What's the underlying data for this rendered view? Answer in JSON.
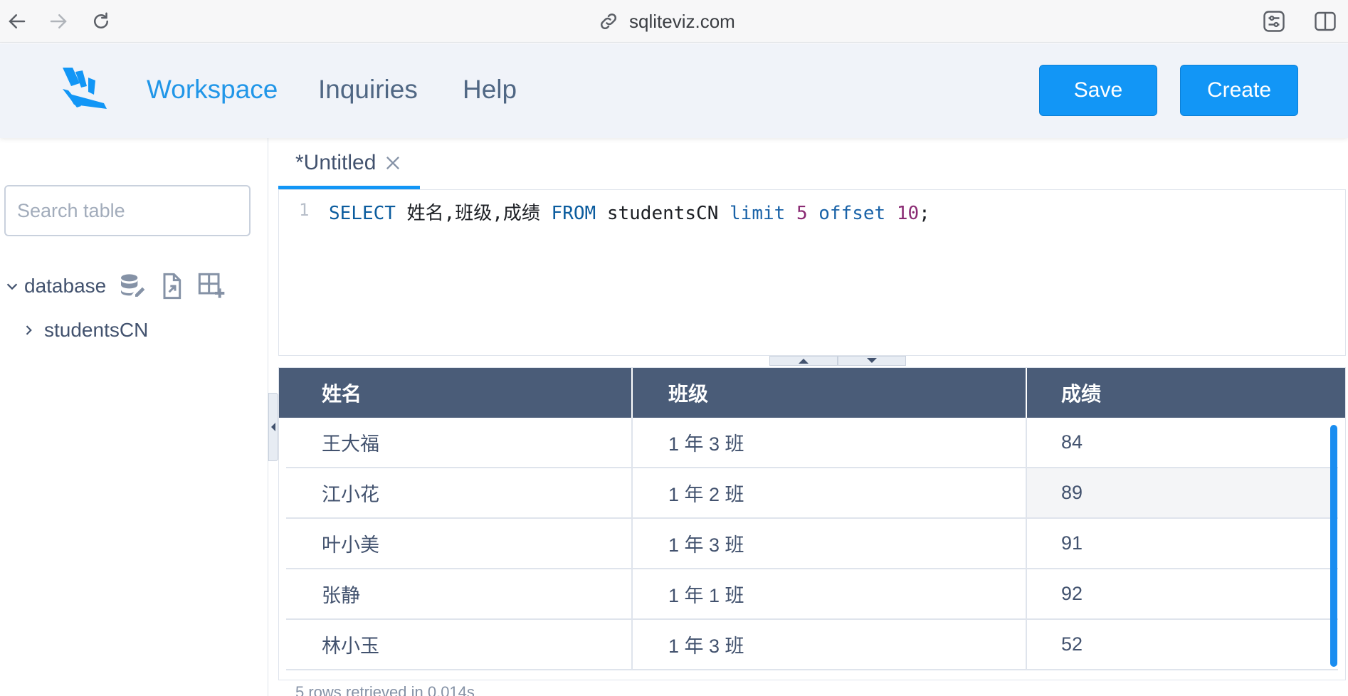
{
  "browser": {
    "url": "sqliteviz.com",
    "icons": [
      "back-arrow-icon",
      "forward-arrow-icon",
      "reload-icon",
      "link-icon",
      "page-settings-icon",
      "sidebar-toggle-icon"
    ]
  },
  "header": {
    "nav": [
      {
        "label": "Workspace",
        "active": true
      },
      {
        "label": "Inquiries",
        "active": false
      },
      {
        "label": "Help",
        "active": false
      }
    ],
    "save_label": "Save",
    "create_label": "Create",
    "accent_color": "#1296f6"
  },
  "sidebar": {
    "search_placeholder": "Search table",
    "database_label": "database",
    "tables": [
      "studentsCN"
    ]
  },
  "editor": {
    "tab_title": "*Untitled",
    "line_number": "1",
    "query": {
      "select": "SELECT",
      "fields": " 姓名,班级,成绩 ",
      "from": "FROM",
      "table": " studentsCN ",
      "limit": "limit",
      "limit_value": " 5 ",
      "offset": "offset",
      "offset_value": " 10",
      "end": ";"
    }
  },
  "results": {
    "columns": [
      "姓名",
      "班级",
      "成绩"
    ],
    "rows": [
      [
        "王大福",
        "1 年 3 班",
        "84"
      ],
      [
        "江小花",
        "1 年 2 班",
        "89"
      ],
      [
        "叶小美",
        "1 年 3 班",
        "91"
      ],
      [
        "张静",
        "1 年 1 班",
        "92"
      ],
      [
        "林小玉",
        "1 年 3 班",
        "52"
      ]
    ],
    "footer": "5 rows retrieved in 0.014s"
  }
}
